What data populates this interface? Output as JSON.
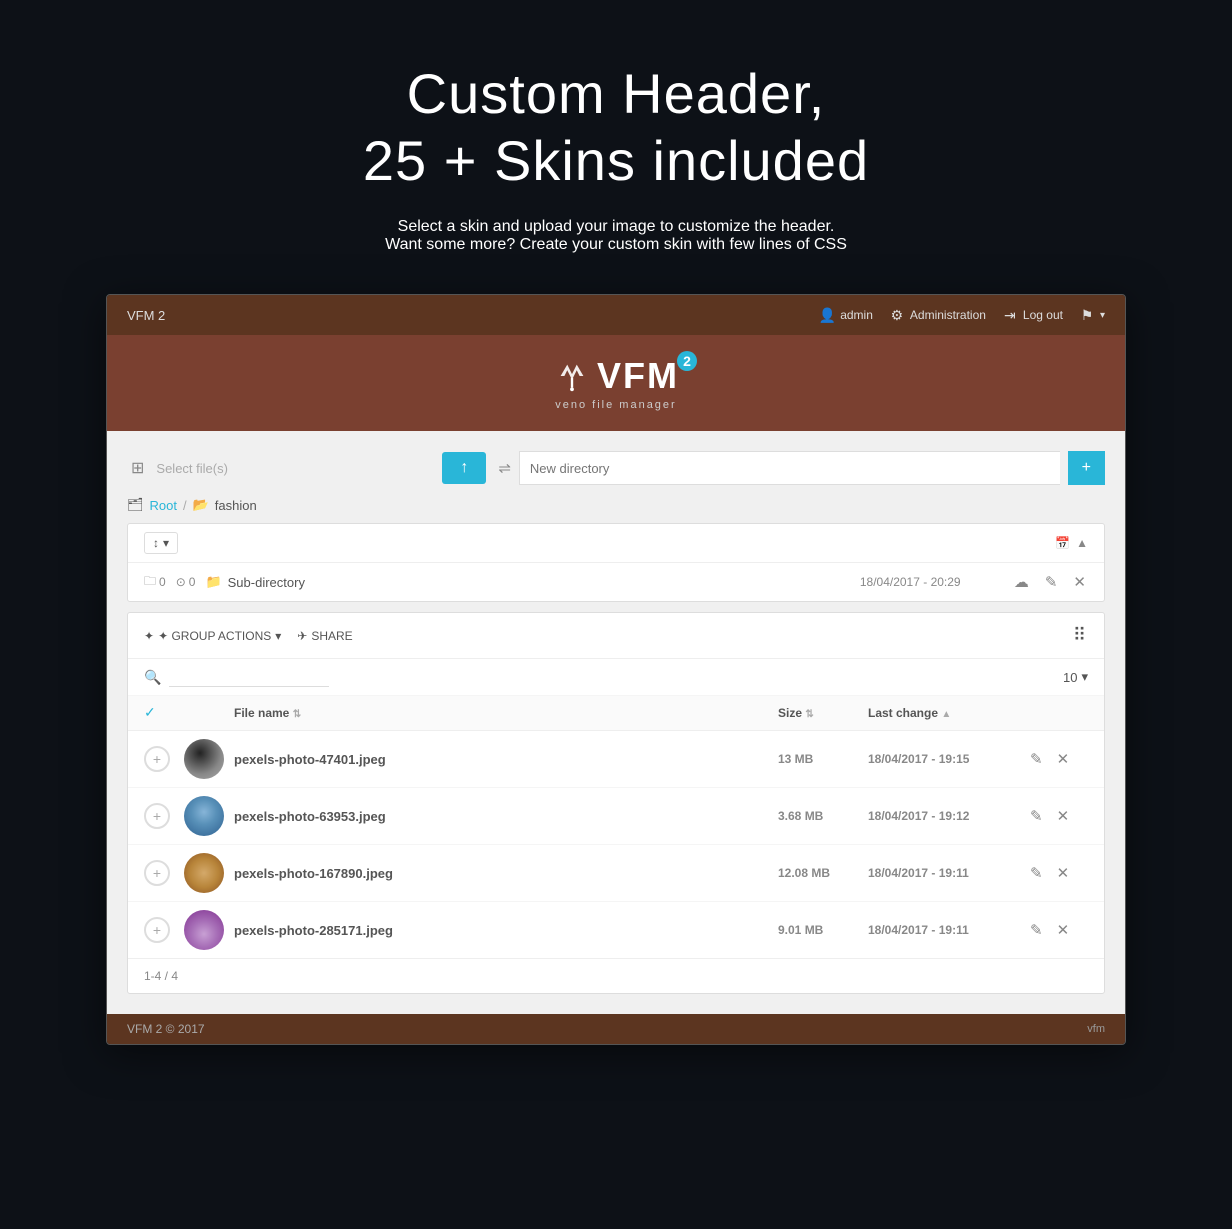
{
  "page": {
    "bg_color": "#0d1117"
  },
  "hero": {
    "title": "Custom Header,\n25 + Skins included",
    "title_line1": "Custom Header,",
    "title_line2": "25 + Skins included",
    "subtitle_line1": "Select a skin and upload your image to customize the header.",
    "subtitle_line2": "Want some more? Create your custom skin with few lines of CSS"
  },
  "navbar": {
    "brand": "VFM 2",
    "user_label": "admin",
    "admin_label": "Administration",
    "logout_label": "Log out",
    "flag_label": ""
  },
  "header": {
    "logo_text": "VFM",
    "superscript": "2",
    "tagline": "veno file manager"
  },
  "toolbar": {
    "select_files_placeholder": "Select file(s)",
    "upload_icon": "↑",
    "new_directory_placeholder": "New directory",
    "add_btn_label": "+"
  },
  "breadcrumb": {
    "root_label": "Root",
    "separator": "/",
    "current_label": "fashion"
  },
  "directory_panel": {
    "sort_label": "↕",
    "date_header": "📅",
    "sub_dir_name": "Sub-directory",
    "sub_dir_files": "0",
    "sub_dir_links": "0",
    "sub_dir_date": "18/04/2017 - 20:29"
  },
  "file_manager": {
    "group_actions_label": "✦ GROUP ACTIONS",
    "share_label": "✈ SHARE",
    "grid_icon": "⠿",
    "search_placeholder": "",
    "per_page_value": "10",
    "columns": {
      "check": "",
      "name": "File name",
      "size": "Size",
      "last_change": "Last change"
    },
    "files": [
      {
        "name": "pexels-photo-47401.jpeg",
        "size": "13 MB",
        "date": "18/04/2017 - 19:15",
        "thumb_class": "thumb-circle-1"
      },
      {
        "name": "pexels-photo-63953.jpeg",
        "size": "3.68 MB",
        "date": "18/04/2017 - 19:12",
        "thumb_class": "thumb-circle-2"
      },
      {
        "name": "pexels-photo-167890.jpeg",
        "size": "12.08 MB",
        "date": "18/04/2017 - 19:11",
        "thumb_class": "thumb-circle-3"
      },
      {
        "name": "pexels-photo-285171.jpeg",
        "size": "9.01 MB",
        "date": "18/04/2017 - 19:11",
        "thumb_class": "thumb-circle-4"
      }
    ],
    "pagination": "1-4 / 4"
  },
  "footer": {
    "copyright": "VFM 2 © 2017",
    "right_text": "vfm"
  }
}
